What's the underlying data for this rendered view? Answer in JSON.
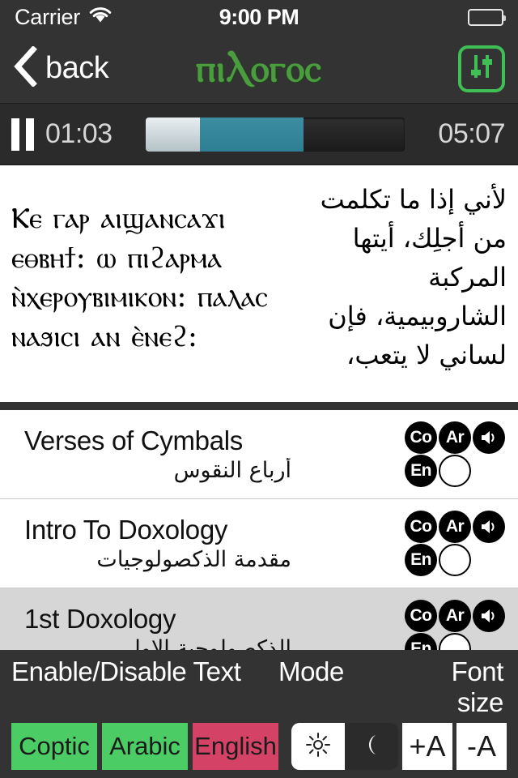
{
  "status_bar": {
    "carrier": "Carrier",
    "wifi_icon": "wifi-icon",
    "time": "9:00 PM",
    "battery_icon": "battery-full-icon"
  },
  "nav_bar": {
    "back_label": "back",
    "back_icon": "chevron-left-icon",
    "brand": "ⲡⲓⲖⲟⲅⲟⲥ",
    "brand_color": "#4a9c3f",
    "settings_icon": "sliders-icon",
    "settings_color": "#3fbf55"
  },
  "player": {
    "pause_icon": "pause-icon",
    "elapsed": "01:03",
    "total": "05:07",
    "buffered_percent": 21,
    "played_percent": 61,
    "played_color": "#2e7f93",
    "buffered_color": "#c6d1d6"
  },
  "text_panel": {
    "coptic": "Ⲕⲉ ⲅⲁⲣ ⲁⲓϣⲁⲛⲥⲁϫⲓ ⲉⲑⲃⲏϯ: ⲱ ⲡⲓϩⲁⲣⲙⲁ ⲛ̀ⲭⲉⲣⲟⲩⲃⲓⲙⲓⲕⲟⲛ: ⲡⲁⲗⲁⲥ ⲛⲁϧⲓⲥⲓ ⲁⲛ ⲉ̀ⲛⲉϩ:",
    "arabic": "لأني إذا ما تكلمت من أجلِك، أيتها المركبة الشاروبيمية، فإن لساني لا يتعب،"
  },
  "hymn_list": {
    "rows": [
      {
        "english": "Verses of Cymbals",
        "arabic": "أرباع النقوس",
        "selected": false,
        "badges": [
          "Co",
          "Ar",
          "speaker-icon",
          "En",
          "empty"
        ]
      },
      {
        "english": "Intro To Doxology",
        "arabic": "مقدمة الذكصولوجيات",
        "selected": false,
        "badges": [
          "Co",
          "Ar",
          "speaker-icon",
          "En",
          "empty"
        ]
      },
      {
        "english": "1st Doxology",
        "arabic": "الذكصولوجية الاولي",
        "selected": true,
        "badges": [
          "Co",
          "Ar",
          "speaker-icon",
          "En",
          "empty"
        ]
      }
    ]
  },
  "toolbar": {
    "label_enable": "Enable/Disable Text",
    "label_mode": "Mode",
    "label_font": "Font size",
    "languages": [
      {
        "label": "Coptic",
        "enabled": true
      },
      {
        "label": "Arabic",
        "enabled": true
      },
      {
        "label": "English",
        "enabled": false
      }
    ],
    "on_color": "#4CCC64",
    "off_color": "#D44365",
    "mode_light_icon": "sun-icon",
    "mode_night_icon": "moon-icon",
    "mode_selected": "night",
    "font_increase": "+A",
    "font_decrease": "-A"
  }
}
